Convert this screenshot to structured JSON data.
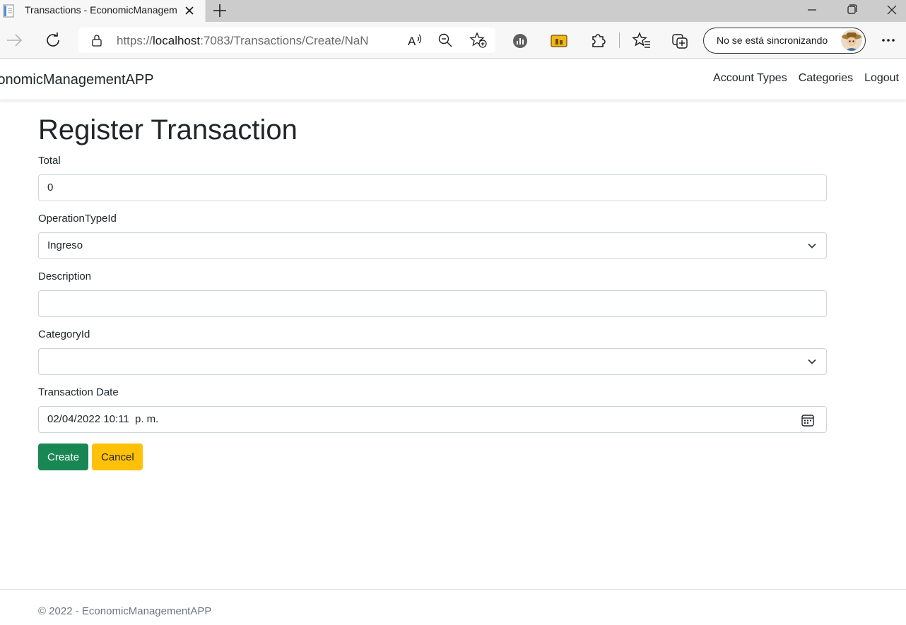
{
  "browser": {
    "tab_title": "Transactions - EconomicManagementAPP",
    "url_prefix": "https://",
    "url_host": "localhost",
    "url_path": ":7083/Transactions/Create/NaN",
    "sync_label": "No se está sincronizando"
  },
  "navbar": {
    "brand": "EconomicManagementAPP",
    "links": [
      "Account Types",
      "Categories",
      "Logout"
    ]
  },
  "form": {
    "heading": "Register Transaction",
    "total_label": "Total",
    "total_value": "0",
    "operation_label": "OperationTypeId",
    "operation_value": "Ingreso",
    "description_label": "Description",
    "description_value": "",
    "category_label": "CategoryId",
    "category_value": "",
    "date_label": "Transaction Date",
    "date_value": "02/04/2022 10:11  p. m.",
    "create_label": "Create",
    "cancel_label": "Cancel"
  },
  "footer": {
    "text": "© 2022 - EconomicManagementAPP"
  },
  "colors": {
    "success": "#198754",
    "warning": "#ffc107"
  }
}
